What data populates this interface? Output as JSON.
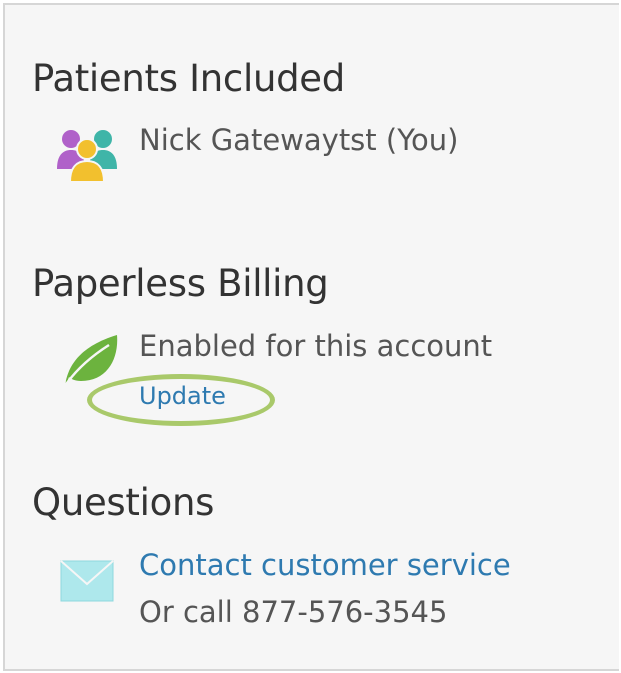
{
  "patients": {
    "title": "Patients Included",
    "icon": "patients-group-icon",
    "name": "Nick Gatewaytst (You)"
  },
  "billing": {
    "title": "Paperless Billing",
    "icon": "leaf-icon",
    "status": "Enabled for this account",
    "update_label": "Update"
  },
  "questions": {
    "title": "Questions",
    "icon": "envelope-icon",
    "contact_label": "Contact customer service",
    "phone_text": "Or call 877-576-3545"
  },
  "colors": {
    "link": "#2e7ab0",
    "highlight": "#a9c96a",
    "leaf": "#6cb33e",
    "envelope": "#aee8ec"
  }
}
